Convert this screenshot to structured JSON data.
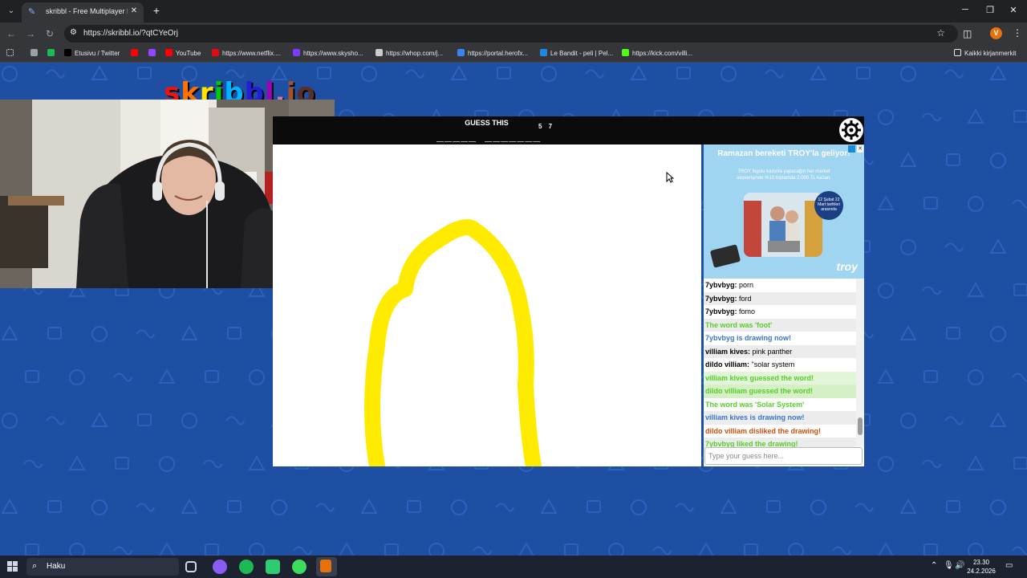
{
  "browser": {
    "tab_title": "skribbl - Free Multiplayer Drawi",
    "url": "https://skribbl.io/?qtCYeOrj",
    "window_controls": [
      "─",
      "❐",
      "✕"
    ],
    "profile_initial": "V",
    "bookmarks": [
      {
        "label": "",
        "icon": "chrome-icon",
        "color": "#9aa0a6"
      },
      {
        "label": "",
        "icon": "spotify-icon",
        "color": "#1db954"
      },
      {
        "label": "Etusivu / Twitter",
        "icon": "x-icon",
        "color": "#000000"
      },
      {
        "label": "",
        "icon": "youtube-icon",
        "color": "#ff0000"
      },
      {
        "label": "",
        "icon": "twitch-icon",
        "color": "#9146ff"
      },
      {
        "label": "YouTube",
        "icon": "youtube-icon",
        "color": "#ff0000"
      },
      {
        "label": "https://www.netflix....",
        "icon": "netflix-icon",
        "color": "#e50914"
      },
      {
        "label": "https://www.skysho...",
        "icon": "skyshowtime-icon",
        "color": "#7a3cff"
      },
      {
        "label": "https://whop.com/j...",
        "icon": "whop-icon",
        "color": "#cccccc"
      },
      {
        "label": "https://portal.herofx...",
        "icon": "herofx-icon",
        "color": "#3b82f6"
      },
      {
        "label": "Le Bandit - peli | Pel...",
        "icon": "play-icon",
        "color": "#1e88e5"
      },
      {
        "label": "https://kick.com/villi...",
        "icon": "kick-icon",
        "color": "#53fc18"
      }
    ],
    "all_bookmarks": "Kaikki kirjanmerkit"
  },
  "game": {
    "logo_letters": [
      {
        "ch": "s",
        "color": "#ef130b"
      },
      {
        "ch": "k",
        "color": "#ff7100"
      },
      {
        "ch": "r",
        "color": "#ffe400"
      },
      {
        "ch": "i",
        "color": "#00cc00"
      },
      {
        "ch": "b",
        "color": "#00b2ff"
      },
      {
        "ch": "b",
        "color": "#231fd3"
      },
      {
        "ch": "l",
        "color": "#a300ba"
      },
      {
        "ch": ".",
        "color": "#d37caa"
      },
      {
        "ch": "i",
        "color": "#a0522d"
      },
      {
        "ch": "o",
        "color": "#592f2a"
      }
    ],
    "guess_label": "GUESS THIS",
    "word_hint": "_____ _______",
    "hint_count": "5 7",
    "stroke_color": "#ffeb00"
  },
  "ad": {
    "title": "Ramazan bereketi TROY'la geliyor!",
    "subtitle": "TROY logolu kartınla yapacağın her market alışverişinde %10 toplamda 2.000 TL kazan.",
    "badge": "12 Şubat 22 Mart tarihleri arasında",
    "brand": "troy"
  },
  "chat": {
    "messages": [
      {
        "name": "7ybvbyg:",
        "text": " porn",
        "style": "normal",
        "bg": "#ffffff"
      },
      {
        "name": "7ybvbyg:",
        "text": " ford",
        "style": "normal",
        "bg": "#ececec"
      },
      {
        "name": "7ybvbyg:",
        "text": " fomo",
        "style": "normal",
        "bg": "#ffffff"
      },
      {
        "name": "",
        "text": "The word was 'foot'",
        "style": "system",
        "color": "#56ce27",
        "bg": "#ececec"
      },
      {
        "name": "",
        "text": "7ybvbyg is drawing now!",
        "style": "system",
        "color": "#3975ce",
        "bg": "#ffffff"
      },
      {
        "name": "villiam kives:",
        "text": " pink panther",
        "style": "normal",
        "bg": "#ececec"
      },
      {
        "name": "dildo villiam:",
        "text": " \"solar system",
        "style": "normal",
        "bg": "#ffffff"
      },
      {
        "name": "",
        "text": "villiam kives guessed the word!",
        "style": "system",
        "color": "#56ce27",
        "bg": "#e2f5d8"
      },
      {
        "name": "",
        "text": "dildo villiam guessed the word!",
        "style": "system",
        "color": "#56ce27",
        "bg": "#d5efc7"
      },
      {
        "name": "",
        "text": "The word was 'Solar System'",
        "style": "system",
        "color": "#56ce27",
        "bg": "#ffffff"
      },
      {
        "name": "",
        "text": "villiam kives is drawing now!",
        "style": "system",
        "color": "#3975ce",
        "bg": "#ececec"
      },
      {
        "name": "",
        "text": "dildo villiam disliked the drawing!",
        "style": "system",
        "color": "#ce4f0a",
        "bg": "#ffffff"
      },
      {
        "name": "",
        "text": "7ybvbyg liked the drawing!",
        "style": "system",
        "color": "#56ce27",
        "bg": "#ececec"
      }
    ],
    "input_placeholder": "Type your guess here..."
  },
  "taskbar": {
    "search_placeholder": "Haku",
    "time": "23.30",
    "date": "24.2.2026"
  }
}
